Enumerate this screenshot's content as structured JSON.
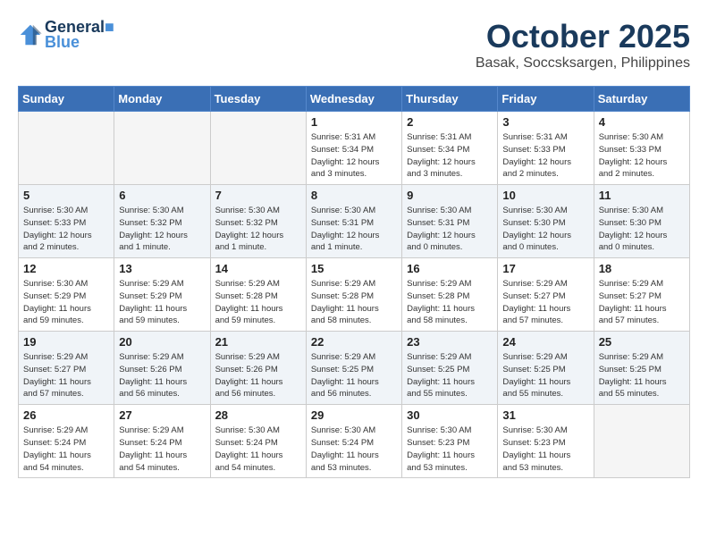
{
  "header": {
    "logo_line1": "General",
    "logo_line2": "Blue",
    "month": "October 2025",
    "location": "Basak, Soccsksargen, Philippines"
  },
  "days_of_week": [
    "Sunday",
    "Monday",
    "Tuesday",
    "Wednesday",
    "Thursday",
    "Friday",
    "Saturday"
  ],
  "weeks": [
    {
      "days": [
        {
          "num": "",
          "info": ""
        },
        {
          "num": "",
          "info": ""
        },
        {
          "num": "",
          "info": ""
        },
        {
          "num": "1",
          "info": "Sunrise: 5:31 AM\nSunset: 5:34 PM\nDaylight: 12 hours\nand 3 minutes."
        },
        {
          "num": "2",
          "info": "Sunrise: 5:31 AM\nSunset: 5:34 PM\nDaylight: 12 hours\nand 3 minutes."
        },
        {
          "num": "3",
          "info": "Sunrise: 5:31 AM\nSunset: 5:33 PM\nDaylight: 12 hours\nand 2 minutes."
        },
        {
          "num": "4",
          "info": "Sunrise: 5:30 AM\nSunset: 5:33 PM\nDaylight: 12 hours\nand 2 minutes."
        }
      ]
    },
    {
      "days": [
        {
          "num": "5",
          "info": "Sunrise: 5:30 AM\nSunset: 5:33 PM\nDaylight: 12 hours\nand 2 minutes."
        },
        {
          "num": "6",
          "info": "Sunrise: 5:30 AM\nSunset: 5:32 PM\nDaylight: 12 hours\nand 1 minute."
        },
        {
          "num": "7",
          "info": "Sunrise: 5:30 AM\nSunset: 5:32 PM\nDaylight: 12 hours\nand 1 minute."
        },
        {
          "num": "8",
          "info": "Sunrise: 5:30 AM\nSunset: 5:31 PM\nDaylight: 12 hours\nand 1 minute."
        },
        {
          "num": "9",
          "info": "Sunrise: 5:30 AM\nSunset: 5:31 PM\nDaylight: 12 hours\nand 0 minutes."
        },
        {
          "num": "10",
          "info": "Sunrise: 5:30 AM\nSunset: 5:30 PM\nDaylight: 12 hours\nand 0 minutes."
        },
        {
          "num": "11",
          "info": "Sunrise: 5:30 AM\nSunset: 5:30 PM\nDaylight: 12 hours\nand 0 minutes."
        }
      ]
    },
    {
      "days": [
        {
          "num": "12",
          "info": "Sunrise: 5:30 AM\nSunset: 5:29 PM\nDaylight: 11 hours\nand 59 minutes."
        },
        {
          "num": "13",
          "info": "Sunrise: 5:29 AM\nSunset: 5:29 PM\nDaylight: 11 hours\nand 59 minutes."
        },
        {
          "num": "14",
          "info": "Sunrise: 5:29 AM\nSunset: 5:28 PM\nDaylight: 11 hours\nand 59 minutes."
        },
        {
          "num": "15",
          "info": "Sunrise: 5:29 AM\nSunset: 5:28 PM\nDaylight: 11 hours\nand 58 minutes."
        },
        {
          "num": "16",
          "info": "Sunrise: 5:29 AM\nSunset: 5:28 PM\nDaylight: 11 hours\nand 58 minutes."
        },
        {
          "num": "17",
          "info": "Sunrise: 5:29 AM\nSunset: 5:27 PM\nDaylight: 11 hours\nand 57 minutes."
        },
        {
          "num": "18",
          "info": "Sunrise: 5:29 AM\nSunset: 5:27 PM\nDaylight: 11 hours\nand 57 minutes."
        }
      ]
    },
    {
      "days": [
        {
          "num": "19",
          "info": "Sunrise: 5:29 AM\nSunset: 5:27 PM\nDaylight: 11 hours\nand 57 minutes."
        },
        {
          "num": "20",
          "info": "Sunrise: 5:29 AM\nSunset: 5:26 PM\nDaylight: 11 hours\nand 56 minutes."
        },
        {
          "num": "21",
          "info": "Sunrise: 5:29 AM\nSunset: 5:26 PM\nDaylight: 11 hours\nand 56 minutes."
        },
        {
          "num": "22",
          "info": "Sunrise: 5:29 AM\nSunset: 5:25 PM\nDaylight: 11 hours\nand 56 minutes."
        },
        {
          "num": "23",
          "info": "Sunrise: 5:29 AM\nSunset: 5:25 PM\nDaylight: 11 hours\nand 55 minutes."
        },
        {
          "num": "24",
          "info": "Sunrise: 5:29 AM\nSunset: 5:25 PM\nDaylight: 11 hours\nand 55 minutes."
        },
        {
          "num": "25",
          "info": "Sunrise: 5:29 AM\nSunset: 5:25 PM\nDaylight: 11 hours\nand 55 minutes."
        }
      ]
    },
    {
      "days": [
        {
          "num": "26",
          "info": "Sunrise: 5:29 AM\nSunset: 5:24 PM\nDaylight: 11 hours\nand 54 minutes."
        },
        {
          "num": "27",
          "info": "Sunrise: 5:29 AM\nSunset: 5:24 PM\nDaylight: 11 hours\nand 54 minutes."
        },
        {
          "num": "28",
          "info": "Sunrise: 5:30 AM\nSunset: 5:24 PM\nDaylight: 11 hours\nand 54 minutes."
        },
        {
          "num": "29",
          "info": "Sunrise: 5:30 AM\nSunset: 5:24 PM\nDaylight: 11 hours\nand 53 minutes."
        },
        {
          "num": "30",
          "info": "Sunrise: 5:30 AM\nSunset: 5:23 PM\nDaylight: 11 hours\nand 53 minutes."
        },
        {
          "num": "31",
          "info": "Sunrise: 5:30 AM\nSunset: 5:23 PM\nDaylight: 11 hours\nand 53 minutes."
        },
        {
          "num": "",
          "info": ""
        }
      ]
    }
  ]
}
